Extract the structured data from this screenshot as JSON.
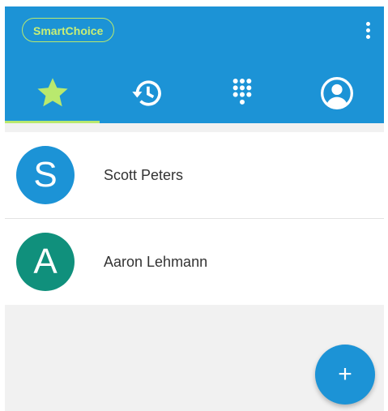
{
  "header": {
    "brand_label": "SmartChoice",
    "tabs": [
      {
        "id": "favorites",
        "icon": "star-icon",
        "active": true
      },
      {
        "id": "recents",
        "icon": "history-icon",
        "active": false
      },
      {
        "id": "keypad",
        "icon": "dialpad-icon",
        "active": false
      },
      {
        "id": "contacts",
        "icon": "account-icon",
        "active": false
      }
    ]
  },
  "contacts": [
    {
      "initial": "S",
      "name": "Scott Peters",
      "avatar_color": "#1c93d6"
    },
    {
      "initial": "A",
      "name": "Aaron Lehmann",
      "avatar_color": "#10907c"
    }
  ],
  "fab": {
    "icon": "plus-icon",
    "label": "+"
  },
  "colors": {
    "appbar": "#1c93d6",
    "accent": "#b9e96e",
    "star": "#b9e96e"
  }
}
